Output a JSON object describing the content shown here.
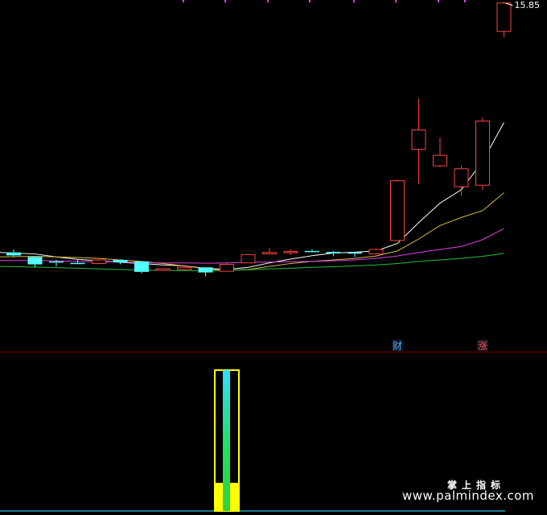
{
  "chart_data": {
    "type": "candlestick",
    "last_price_label": "15.85",
    "candles": [
      {
        "open": 7.45,
        "high": 7.55,
        "low": 7.3,
        "close": 7.35
      },
      {
        "open": 7.3,
        "high": 7.3,
        "low": 6.95,
        "close": 7.05
      },
      {
        "open": 7.15,
        "high": 7.2,
        "low": 6.98,
        "close": 7.12
      },
      {
        "open": 7.1,
        "high": 7.2,
        "low": 7.05,
        "close": 7.08
      },
      {
        "open": 7.08,
        "high": 7.25,
        "low": 7.05,
        "close": 7.2
      },
      {
        "open": 7.2,
        "high": 7.2,
        "low": 7.05,
        "close": 7.12
      },
      {
        "open": 7.15,
        "high": 7.15,
        "low": 6.75,
        "close": 6.8
      },
      {
        "open": 6.85,
        "high": 6.92,
        "low": 6.83,
        "close": 6.9
      },
      {
        "open": 6.88,
        "high": 6.98,
        "low": 6.85,
        "close": 6.95
      },
      {
        "open": 6.95,
        "high": 6.95,
        "low": 6.65,
        "close": 6.78
      },
      {
        "open": 6.82,
        "high": 7.1,
        "low": 6.82,
        "close": 7.05
      },
      {
        "open": 7.1,
        "high": 7.4,
        "low": 7.1,
        "close": 7.38
      },
      {
        "open": 7.4,
        "high": 7.6,
        "low": 7.38,
        "close": 7.45
      },
      {
        "open": 7.45,
        "high": 7.55,
        "low": 7.38,
        "close": 7.48
      },
      {
        "open": 7.5,
        "high": 7.55,
        "low": 7.45,
        "close": 7.48
      },
      {
        "open": 7.47,
        "high": 7.5,
        "low": 7.32,
        "close": 7.42
      },
      {
        "open": 7.45,
        "high": 7.45,
        "low": 7.3,
        "close": 7.42
      },
      {
        "open": 7.4,
        "high": 7.58,
        "low": 7.38,
        "close": 7.55
      },
      {
        "open": 7.85,
        "high": 9.9,
        "low": 7.85,
        "close": 9.85
      },
      {
        "open": 10.9,
        "high": 12.6,
        "low": 9.75,
        "close": 11.55
      },
      {
        "open": 10.35,
        "high": 11.3,
        "low": 10.3,
        "close": 10.7
      },
      {
        "open": 9.65,
        "high": 10.35,
        "low": 9.35,
        "close": 10.25
      },
      {
        "open": 9.7,
        "high": 11.95,
        "low": 9.55,
        "close": 11.85
      },
      {
        "open": 14.85,
        "high": 15.85,
        "low": 14.65,
        "close": 15.8
      }
    ],
    "ma_lines": [
      {
        "color": "#ffffff",
        "values": [
          7.45,
          7.4,
          7.3,
          7.22,
          7.17,
          7.12,
          7.08,
          7.03,
          7.0,
          6.92,
          6.88,
          6.95,
          7.1,
          7.23,
          7.34,
          7.43,
          7.46,
          7.5,
          7.75,
          8.45,
          9.1,
          9.55,
          10.5,
          11.8
        ]
      },
      {
        "color": "#d8b840",
        "values": [
          7.3,
          7.32,
          7.3,
          7.28,
          7.25,
          7.2,
          7.15,
          7.08,
          7.0,
          6.9,
          6.85,
          6.88,
          6.98,
          7.08,
          7.15,
          7.2,
          7.25,
          7.33,
          7.5,
          7.9,
          8.35,
          8.62,
          8.85,
          9.45
        ]
      },
      {
        "color": "#e040e0",
        "values": [
          7.18,
          7.18,
          7.17,
          7.15,
          7.14,
          7.13,
          7.11,
          7.1,
          7.1,
          7.09,
          7.1,
          7.12,
          7.13,
          7.14,
          7.15,
          7.17,
          7.2,
          7.25,
          7.33,
          7.45,
          7.55,
          7.65,
          7.88,
          8.25
        ]
      },
      {
        "color": "#20c040",
        "values": [
          6.98,
          6.96,
          6.94,
          6.92,
          6.9,
          6.88,
          6.86,
          6.85,
          6.84,
          6.84,
          6.85,
          6.87,
          6.9,
          6.92,
          6.95,
          6.97,
          7.0,
          7.03,
          7.08,
          7.15,
          7.2,
          7.25,
          7.32,
          7.42
        ]
      }
    ],
    "markers": [
      {
        "text": "财",
        "candle_index": 18,
        "color": "#4aa8ff"
      },
      {
        "text": "涨",
        "candle_index": 22,
        "color": "#ff5050"
      }
    ],
    "indicator": {
      "candle_index": 10,
      "value": 1.0,
      "base_value": 0.2
    }
  },
  "watermark": {
    "line1": "掌上指标",
    "line2": "www.palmindex.com"
  }
}
